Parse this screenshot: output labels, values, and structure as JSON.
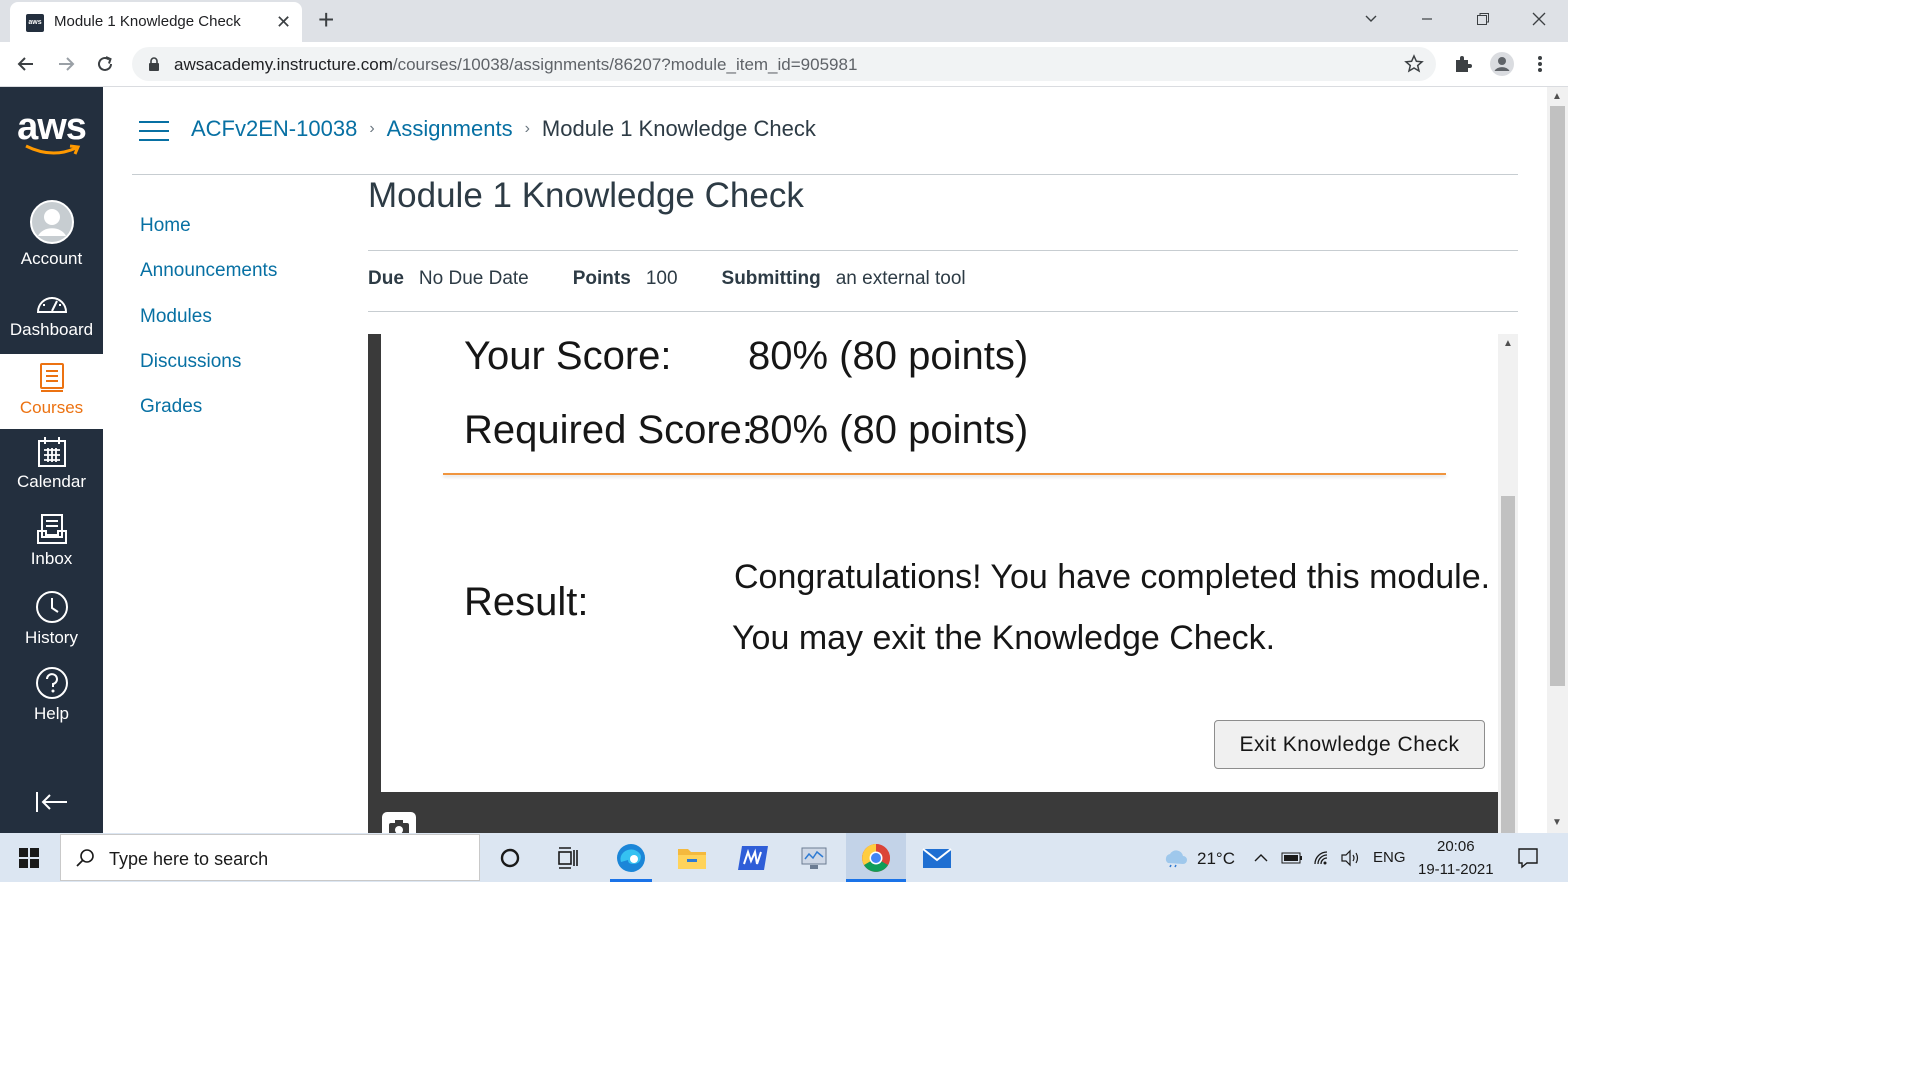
{
  "browser": {
    "tab_title": "Module 1 Knowledge Check",
    "favicon_text": "aws",
    "url_host": "awsacademy.instructure.com",
    "url_path": "/courses/10038/assignments/86207?module_item_id=905981"
  },
  "global_nav": {
    "logo": "aws",
    "items": [
      {
        "label": "Account",
        "icon": "account-icon"
      },
      {
        "label": "Dashboard",
        "icon": "dashboard-icon"
      },
      {
        "label": "Courses",
        "icon": "courses-icon",
        "active": true
      },
      {
        "label": "Calendar",
        "icon": "calendar-icon"
      },
      {
        "label": "Inbox",
        "icon": "inbox-icon"
      },
      {
        "label": "History",
        "icon": "history-icon"
      },
      {
        "label": "Help",
        "icon": "help-icon"
      }
    ]
  },
  "breadcrumb": {
    "course": "ACFv2EN-10038",
    "section": "Assignments",
    "current": "Module 1 Knowledge Check"
  },
  "course_nav": [
    "Home",
    "Announcements",
    "Modules",
    "Discussions",
    "Grades"
  ],
  "assignment": {
    "title": "Module 1 Knowledge Check",
    "due_label": "Due",
    "due_value": "No Due Date",
    "points_label": "Points",
    "points_value": "100",
    "submitting_label": "Submitting",
    "submitting_value": "an external tool"
  },
  "tool": {
    "score_label": "Your Score:",
    "score_value": "80% (80 points)",
    "required_label": "Required Score:",
    "required_value": "80% (80 points)",
    "result_label": "Result:",
    "result_line1": "Congratulations! You have completed this module.",
    "result_line2": "You may exit the Knowledge Check.",
    "exit_button": "Exit Knowledge Check"
  },
  "taskbar": {
    "search_placeholder": "Type here to search",
    "temperature": "21°C",
    "language": "ENG",
    "time": "20:06",
    "date": "19-11-2021"
  },
  "colors": {
    "nav_bg": "#232f3e",
    "accent_orange": "#ec7211",
    "link_blue": "#0770a3"
  }
}
